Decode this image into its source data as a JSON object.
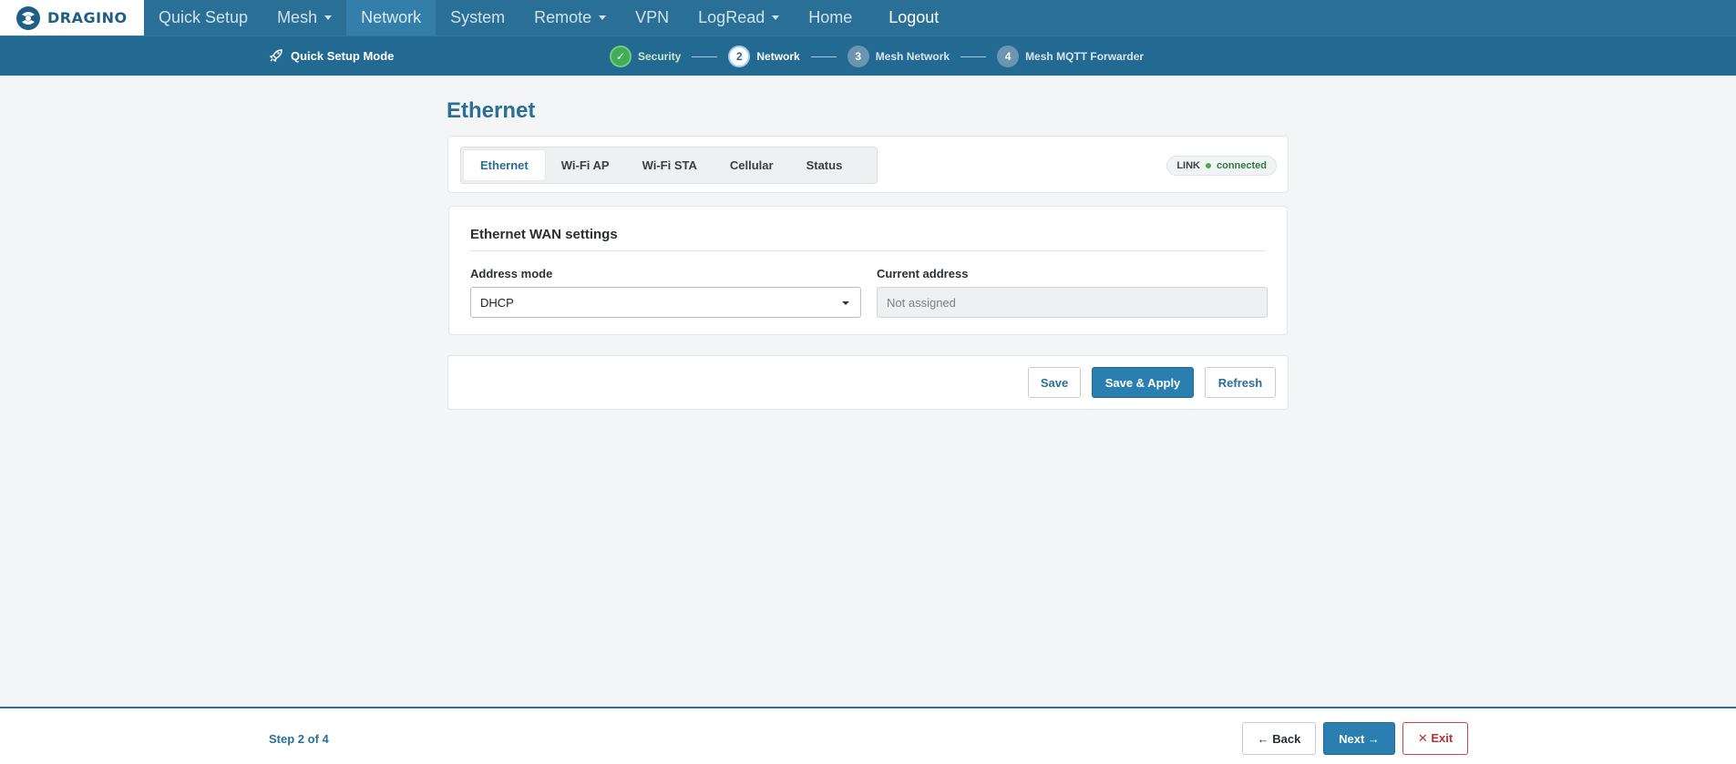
{
  "brand": {
    "logo_text": "DRAGINO"
  },
  "nav": {
    "items": [
      {
        "label": "Quick Setup",
        "dropdown": false,
        "active": false
      },
      {
        "label": "Mesh",
        "dropdown": true,
        "active": false
      },
      {
        "label": "Network",
        "dropdown": false,
        "active": true
      },
      {
        "label": "System",
        "dropdown": false,
        "active": false
      },
      {
        "label": "Remote",
        "dropdown": true,
        "active": false
      },
      {
        "label": "VPN",
        "dropdown": false,
        "active": false
      },
      {
        "label": "LogRead",
        "dropdown": true,
        "active": false
      },
      {
        "label": "Home",
        "dropdown": false,
        "active": false
      }
    ],
    "logout_label": "Logout"
  },
  "wizard": {
    "mode_label": "Quick Setup Mode",
    "mode_icon": "rocket-icon",
    "steps": [
      {
        "marker": "✓",
        "label": "Security",
        "state": "done"
      },
      {
        "marker": "2",
        "label": "Network",
        "state": "current"
      },
      {
        "marker": "3",
        "label": "Mesh Network",
        "state": "todo"
      },
      {
        "marker": "4",
        "label": "Mesh MQTT Forwarder",
        "state": "todo"
      }
    ]
  },
  "page": {
    "title": "Ethernet"
  },
  "tabs": [
    {
      "label": "Ethernet",
      "active": true
    },
    {
      "label": "Wi-Fi AP",
      "active": false
    },
    {
      "label": "Wi-Fi STA",
      "active": false
    },
    {
      "label": "Cellular",
      "active": false
    },
    {
      "label": "Status",
      "active": false
    }
  ],
  "link": {
    "label": "LINK",
    "status": "connected",
    "status_color": "#3fae54"
  },
  "settings": {
    "title": "Ethernet WAN settings",
    "address_mode_label": "Address mode",
    "address_mode_value": "DHCP",
    "current_address_label": "Current address",
    "current_address_placeholder": "Not assigned"
  },
  "actions": {
    "save_label": "Save",
    "save_apply_label": "Save & Apply",
    "refresh_label": "Refresh"
  },
  "footer": {
    "step_count": "Step 2 of 4",
    "back_label": "← Back",
    "next_label": "Next →",
    "exit_label": "✕ Exit"
  },
  "colors": {
    "nav_bg": "#2a6f96",
    "primary": "#2b7fb0",
    "success": "#3fae54",
    "danger": "#c94444"
  }
}
